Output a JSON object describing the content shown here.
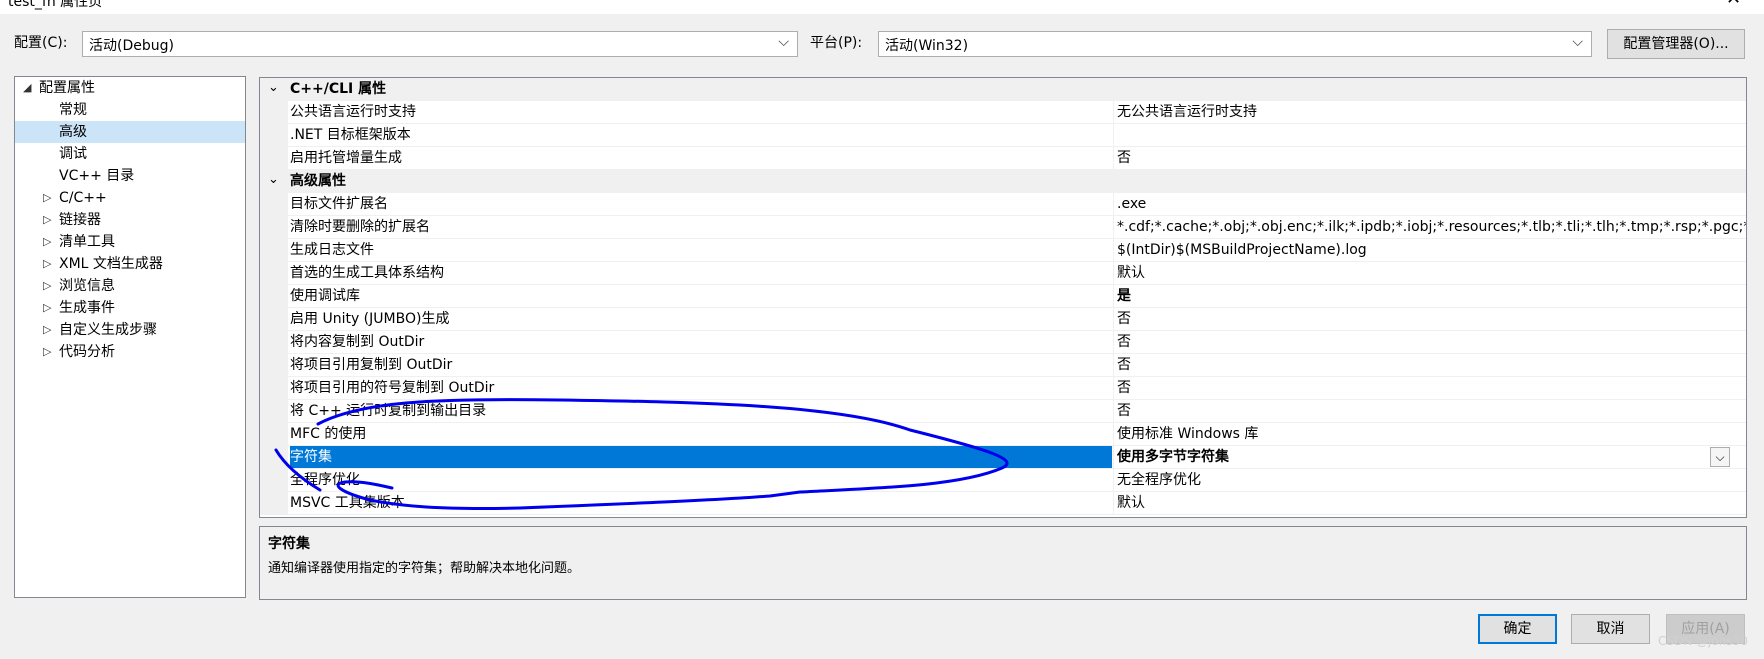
{
  "window": {
    "title": "test_fn 属性页"
  },
  "toolbar": {
    "config_label": "配置(C):",
    "config_value": "活动(Debug)",
    "platform_label": "平台(P):",
    "platform_value": "活动(Win32)",
    "config_manager": "配置管理器(O)..."
  },
  "tree": {
    "root": "配置属性",
    "items": [
      {
        "label": "常规",
        "expandable": false
      },
      {
        "label": "高级",
        "expandable": false,
        "selected": true
      },
      {
        "label": "调试",
        "expandable": false
      },
      {
        "label": "VC++ 目录",
        "expandable": false
      },
      {
        "label": "C/C++",
        "expandable": true
      },
      {
        "label": "链接器",
        "expandable": true
      },
      {
        "label": "清单工具",
        "expandable": true
      },
      {
        "label": "XML 文档生成器",
        "expandable": true
      },
      {
        "label": "浏览信息",
        "expandable": true
      },
      {
        "label": "生成事件",
        "expandable": true
      },
      {
        "label": "自定义生成步骤",
        "expandable": true
      },
      {
        "label": "代码分析",
        "expandable": true
      }
    ]
  },
  "grid": {
    "rows": [
      {
        "type": "category",
        "name": "C++/CLI 属性"
      },
      {
        "name": "公共语言运行时支持",
        "value": "无公共语言运行时支持"
      },
      {
        "name": ".NET 目标框架版本",
        "value": ""
      },
      {
        "name": "启用托管增量生成",
        "value": "否"
      },
      {
        "type": "category",
        "name": "高级属性"
      },
      {
        "name": "目标文件扩展名",
        "value": ".exe"
      },
      {
        "name": "清除时要删除的扩展名",
        "value": "*.cdf;*.cache;*.obj;*.obj.enc;*.ilk;*.ipdb;*.iobj;*.resources;*.tlb;*.tli;*.tlh;*.tmp;*.rsp;*.pgc;*.pgd;*.meta;*.tlog;*.manifest;*.res"
      },
      {
        "name": "生成日志文件",
        "value": "$(IntDir)$(MSBuildProjectName).log"
      },
      {
        "name": "首选的生成工具体系结构",
        "value": "默认"
      },
      {
        "name": "使用调试库",
        "value": "是",
        "bold": true
      },
      {
        "name": "启用 Unity (JUMBO)生成",
        "value": "否"
      },
      {
        "name": "将内容复制到 OutDir",
        "value": "否"
      },
      {
        "name": "将项目引用复制到 OutDir",
        "value": "否"
      },
      {
        "name": "将项目引用的符号复制到 OutDir",
        "value": "否"
      },
      {
        "name": "将 C++ 运行时复制到输出目录",
        "value": "否"
      },
      {
        "name": "MFC 的使用",
        "value": "使用标准 Windows 库"
      },
      {
        "name": "字符集",
        "value": "使用多字节字符集",
        "selected": true
      },
      {
        "name": "全程序优化",
        "value": "无全程序优化"
      },
      {
        "name": "MSVC 工具集版本",
        "value": "默认"
      }
    ]
  },
  "description": {
    "title": "字符集",
    "text": "通知编译器使用指定的字符集；帮助解决本地化问题。"
  },
  "buttons": {
    "ok": "确定",
    "cancel": "取消",
    "apply": "应用(A)"
  },
  "watermark": "CSDN @jons30",
  "colors": {
    "selection": "#0078d7",
    "tree_selection": "#cce4f7",
    "annotation": "#0000ee"
  }
}
